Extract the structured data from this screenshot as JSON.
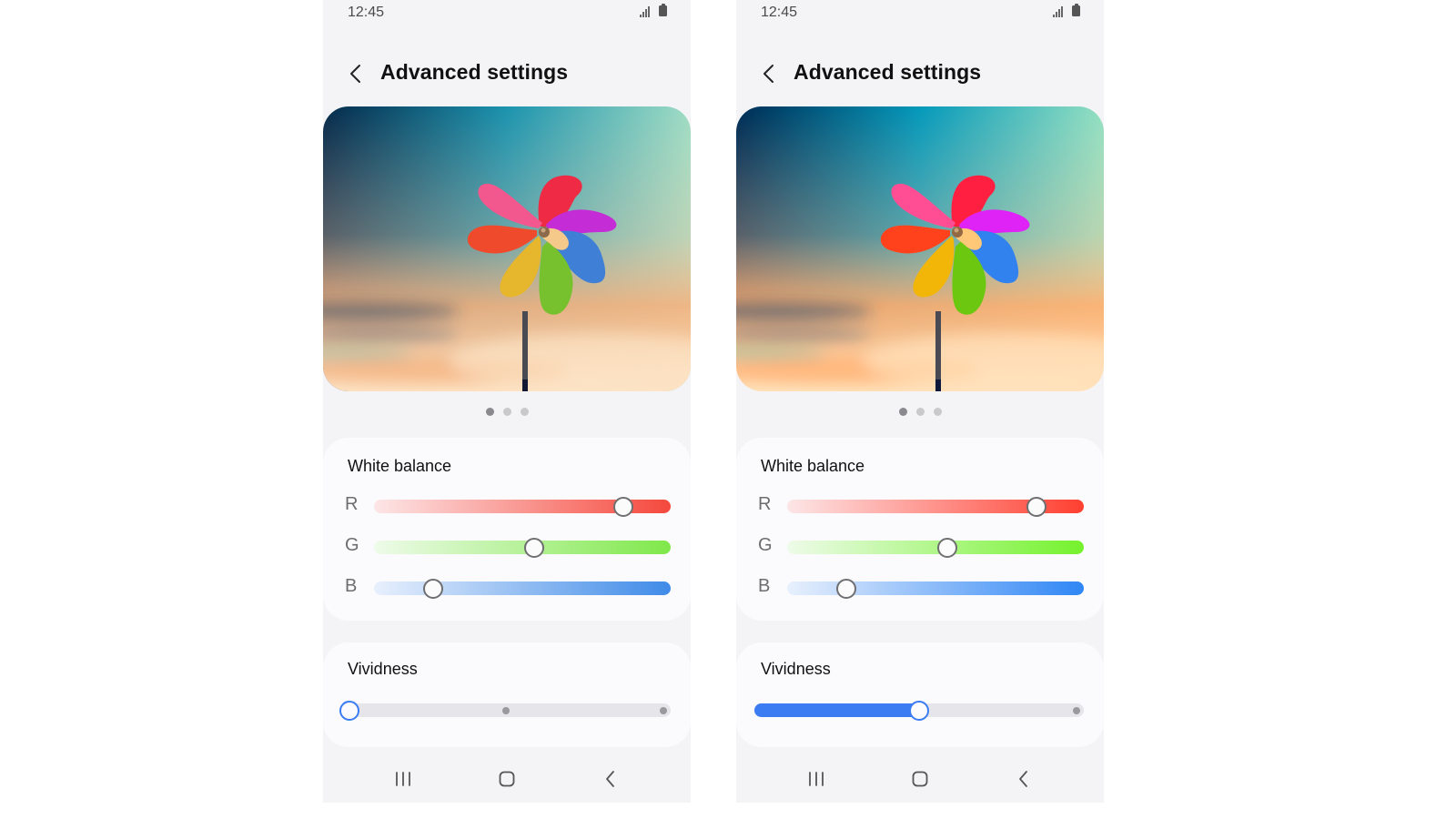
{
  "screens": [
    {
      "id": "before",
      "status_bar": {
        "time": "12:45",
        "icons": [
          "signal-icon",
          "battery-icon"
        ]
      },
      "header": {
        "back_icon": "chevron-left-icon",
        "title": "Advanced settings"
      },
      "preview": {
        "description": "Colorful pinwheel against a blurred teal-to-peach sky",
        "page_count": 3,
        "active_page": 0,
        "vividness_boost": false
      },
      "white_balance": {
        "title": "White balance",
        "channels": [
          {
            "label": "R",
            "value": 0.84,
            "gradient_start": "#fde6e7",
            "gradient_end": "#f5483c"
          },
          {
            "label": "G",
            "value": 0.54,
            "gradient_start": "#eefbe9",
            "gradient_end": "#7fe84a"
          },
          {
            "label": "B",
            "value": 0.2,
            "gradient_start": "#e8f0fd",
            "gradient_end": "#3f8be8"
          }
        ]
      },
      "vividness": {
        "title": "Vividness",
        "steps": 3,
        "value_step": 0,
        "accent": "#3b7cf2"
      },
      "nav_bar": {
        "buttons": [
          "recent-apps-icon",
          "home-icon",
          "back-icon"
        ]
      }
    },
    {
      "id": "after",
      "status_bar": {
        "time": "12:45",
        "icons": [
          "signal-icon",
          "battery-icon"
        ]
      },
      "header": {
        "back_icon": "chevron-left-icon",
        "title": "Advanced settings"
      },
      "preview": {
        "description": "Colorful pinwheel against a blurred teal-to-peach sky (more vivid)",
        "page_count": 3,
        "active_page": 0,
        "vividness_boost": true
      },
      "white_balance": {
        "title": "White balance",
        "channels": [
          {
            "label": "R",
            "value": 0.84,
            "gradient_start": "#fde6e7",
            "gradient_end": "#ff3f30"
          },
          {
            "label": "G",
            "value": 0.54,
            "gradient_start": "#eefbe9",
            "gradient_end": "#74f22c"
          },
          {
            "label": "B",
            "value": 0.2,
            "gradient_start": "#e8f0fd",
            "gradient_end": "#2f86f5"
          }
        ]
      },
      "vividness": {
        "title": "Vividness",
        "steps": 3,
        "value_step": 1,
        "accent": "#3b7cf2"
      },
      "nav_bar": {
        "buttons": [
          "recent-apps-icon",
          "home-icon",
          "back-icon"
        ]
      }
    }
  ]
}
